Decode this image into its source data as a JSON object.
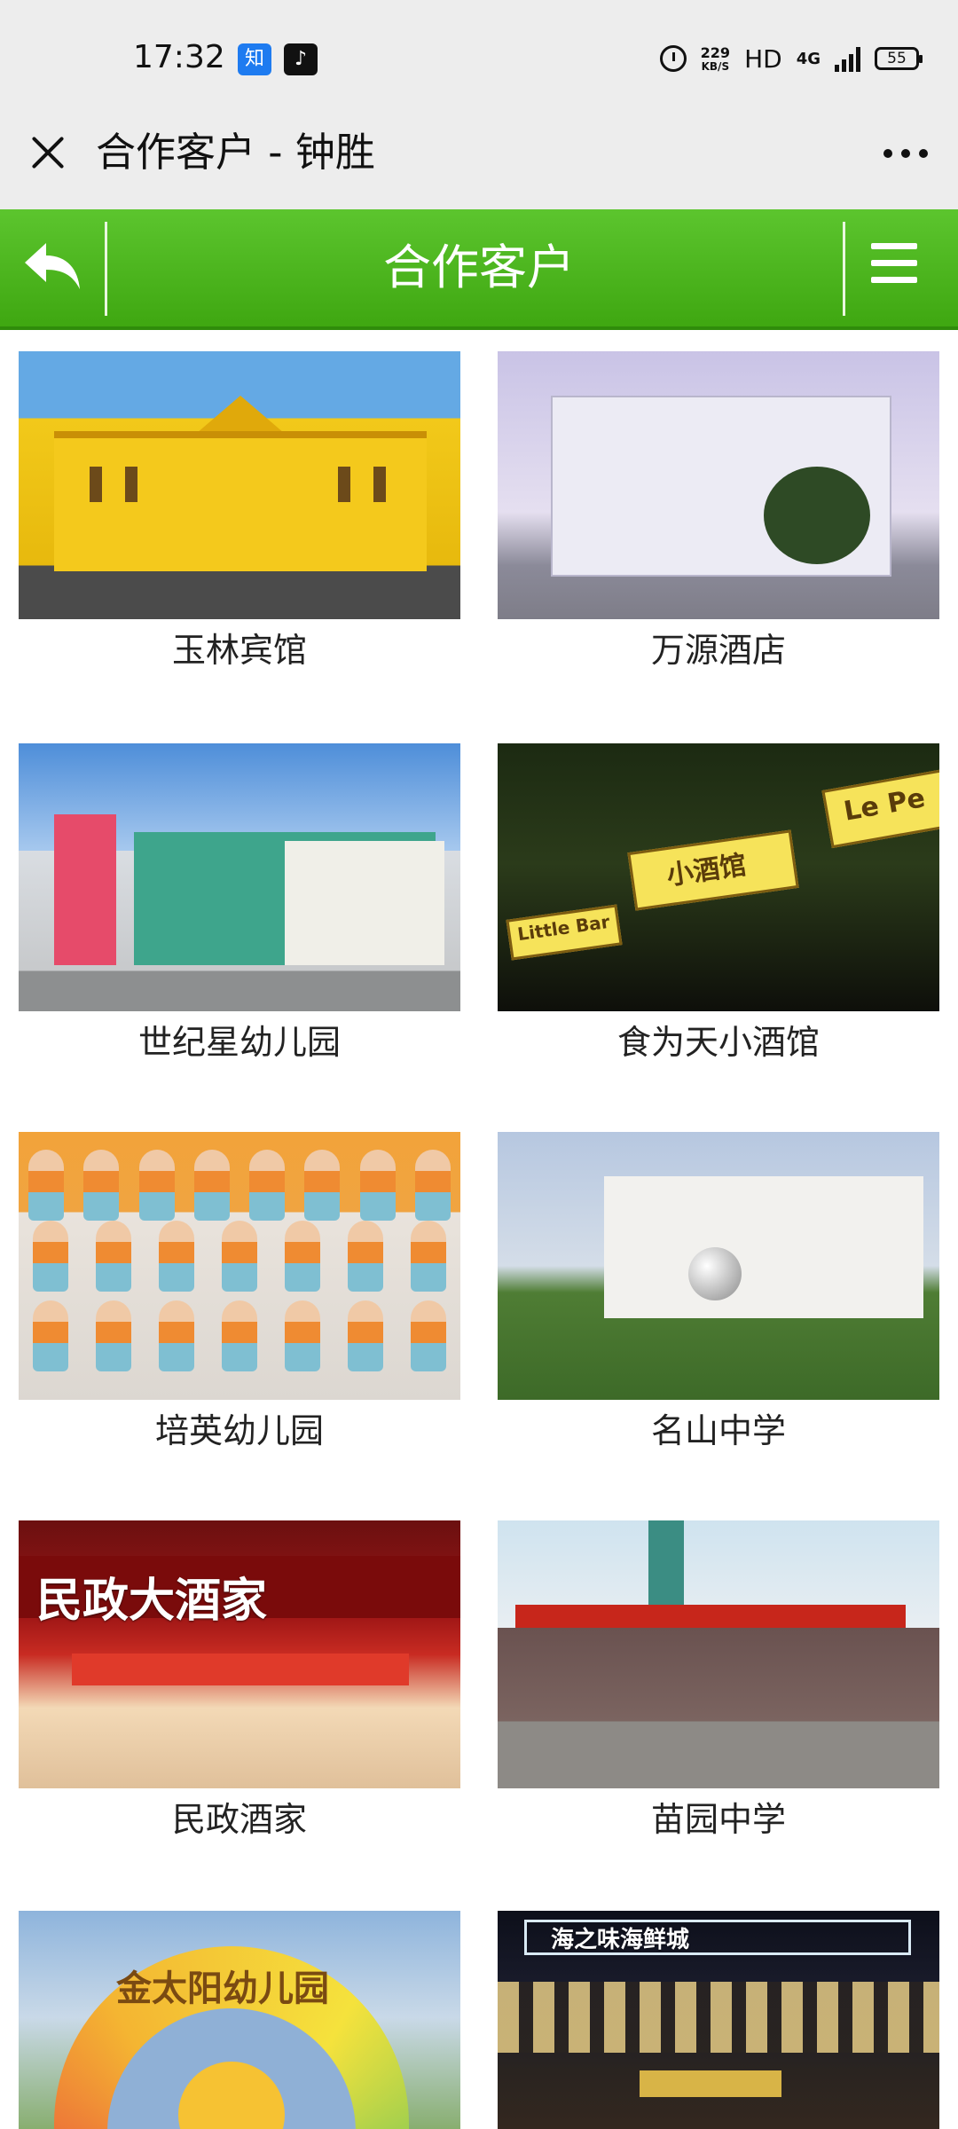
{
  "status_bar": {
    "time": "17:32",
    "app_icon_1": "知",
    "app_icon_2": "♪",
    "speed_value": "229",
    "speed_unit": "KB/S",
    "hd": "HD",
    "network": "4G",
    "battery": "55"
  },
  "titlebar": {
    "title": "合作客户 - 钟胜"
  },
  "header": {
    "title": "合作客户"
  },
  "clients": [
    {
      "name": "玉林宾馆"
    },
    {
      "name": "万源酒店"
    },
    {
      "name": "世纪星幼儿园"
    },
    {
      "name": "食为天小酒馆"
    },
    {
      "name": "培英幼儿园"
    },
    {
      "name": "名山中学"
    },
    {
      "name": "民政酒家"
    },
    {
      "name": "苗园中学"
    },
    {
      "name": "金太阳幼儿园"
    },
    {
      "name": "海之味海鲜城"
    }
  ],
  "image_texts": {
    "bar_sign_1": "小酒馆",
    "bar_sign_2": "Little Bar",
    "bar_sign_3": "Le Pe",
    "minzheng_sign": "民政大酒家",
    "sun_arch": "金太阳幼儿园",
    "seafood_sign": "海之味海鲜城"
  },
  "colors": {
    "header_green": "#4bb21c",
    "background": "#ffffff",
    "chrome_gray": "#ededed"
  }
}
